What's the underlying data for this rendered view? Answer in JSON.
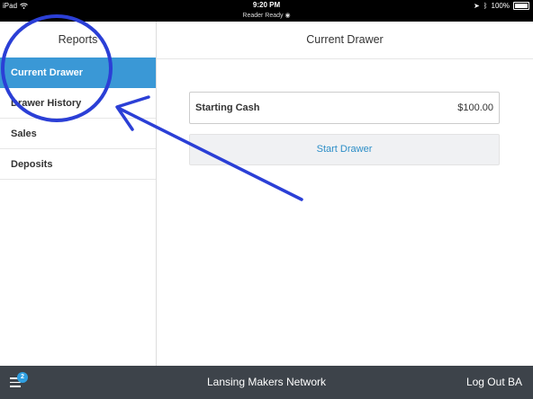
{
  "status_bar": {
    "device": "iPad",
    "time": "9:20 PM",
    "subtitle": "Reader Ready",
    "battery": "100%",
    "wifi_icon": "wifi-icon",
    "bluetooth_icon": "bluetooth-icon",
    "location_icon": "location-arrow-icon"
  },
  "sidebar": {
    "title": "Reports",
    "items": [
      {
        "label": "Current Drawer",
        "active": true
      },
      {
        "label": "Drawer History",
        "active": false
      },
      {
        "label": "Sales",
        "active": false
      },
      {
        "label": "Deposits",
        "active": false
      }
    ]
  },
  "main": {
    "title": "Current Drawer",
    "starting_cash_label": "Starting Cash",
    "starting_cash_value": "$100.00",
    "start_button_label": "Start Drawer"
  },
  "footer": {
    "menu_badge": "2",
    "business_name": "Lansing Makers Network",
    "logout_label": "Log Out BA"
  },
  "colors": {
    "active_item": "#3a98d6",
    "link_blue": "#2c8ec7",
    "footer_bg": "#3d434a",
    "annotation_blue": "#2b3fd6"
  }
}
